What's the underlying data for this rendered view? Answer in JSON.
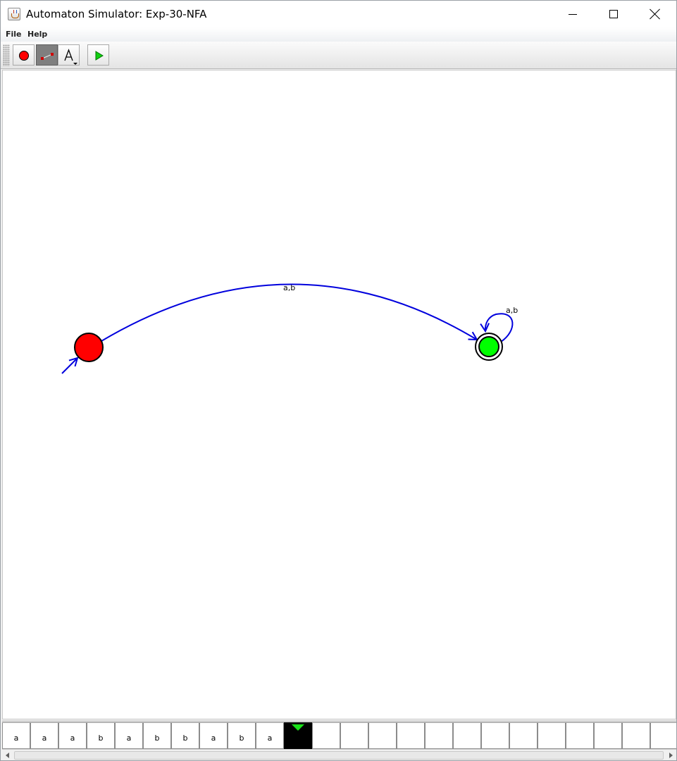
{
  "window": {
    "title": "Automaton Simulator: Exp-30-NFA"
  },
  "menu": {
    "items": [
      {
        "label": "File"
      },
      {
        "label": "Help"
      }
    ]
  },
  "toolbar": {
    "tools": [
      {
        "name": "state-tool",
        "icon": "red-circle-icon",
        "active": false
      },
      {
        "name": "transition-tool",
        "icon": "transition-line-icon",
        "active": true
      },
      {
        "name": "label-tool",
        "icon": "text-A-icon",
        "active": false
      },
      {
        "name": "run-tool",
        "icon": "green-play-icon",
        "active": false
      }
    ]
  },
  "automaton": {
    "states": [
      {
        "id": "start",
        "color": "#ff0000",
        "initial": true,
        "accepting": false
      },
      {
        "id": "final",
        "color": "#00ff00",
        "initial": false,
        "accepting": true
      }
    ],
    "transitions": [
      {
        "from": "start",
        "to": "final",
        "label": "a,b"
      },
      {
        "from": "final",
        "to": "final",
        "label": "a,b"
      }
    ],
    "edge_color": "#0000dd"
  },
  "tape": {
    "symbols": [
      "a",
      "a",
      "a",
      "b",
      "a",
      "b",
      "b",
      "a",
      "b",
      "a",
      "",
      "",
      "",
      "",
      "",
      "",
      "",
      "",
      "",
      "",
      "",
      "",
      "",
      ""
    ],
    "head_index": 10,
    "head_color": "#18e018"
  }
}
